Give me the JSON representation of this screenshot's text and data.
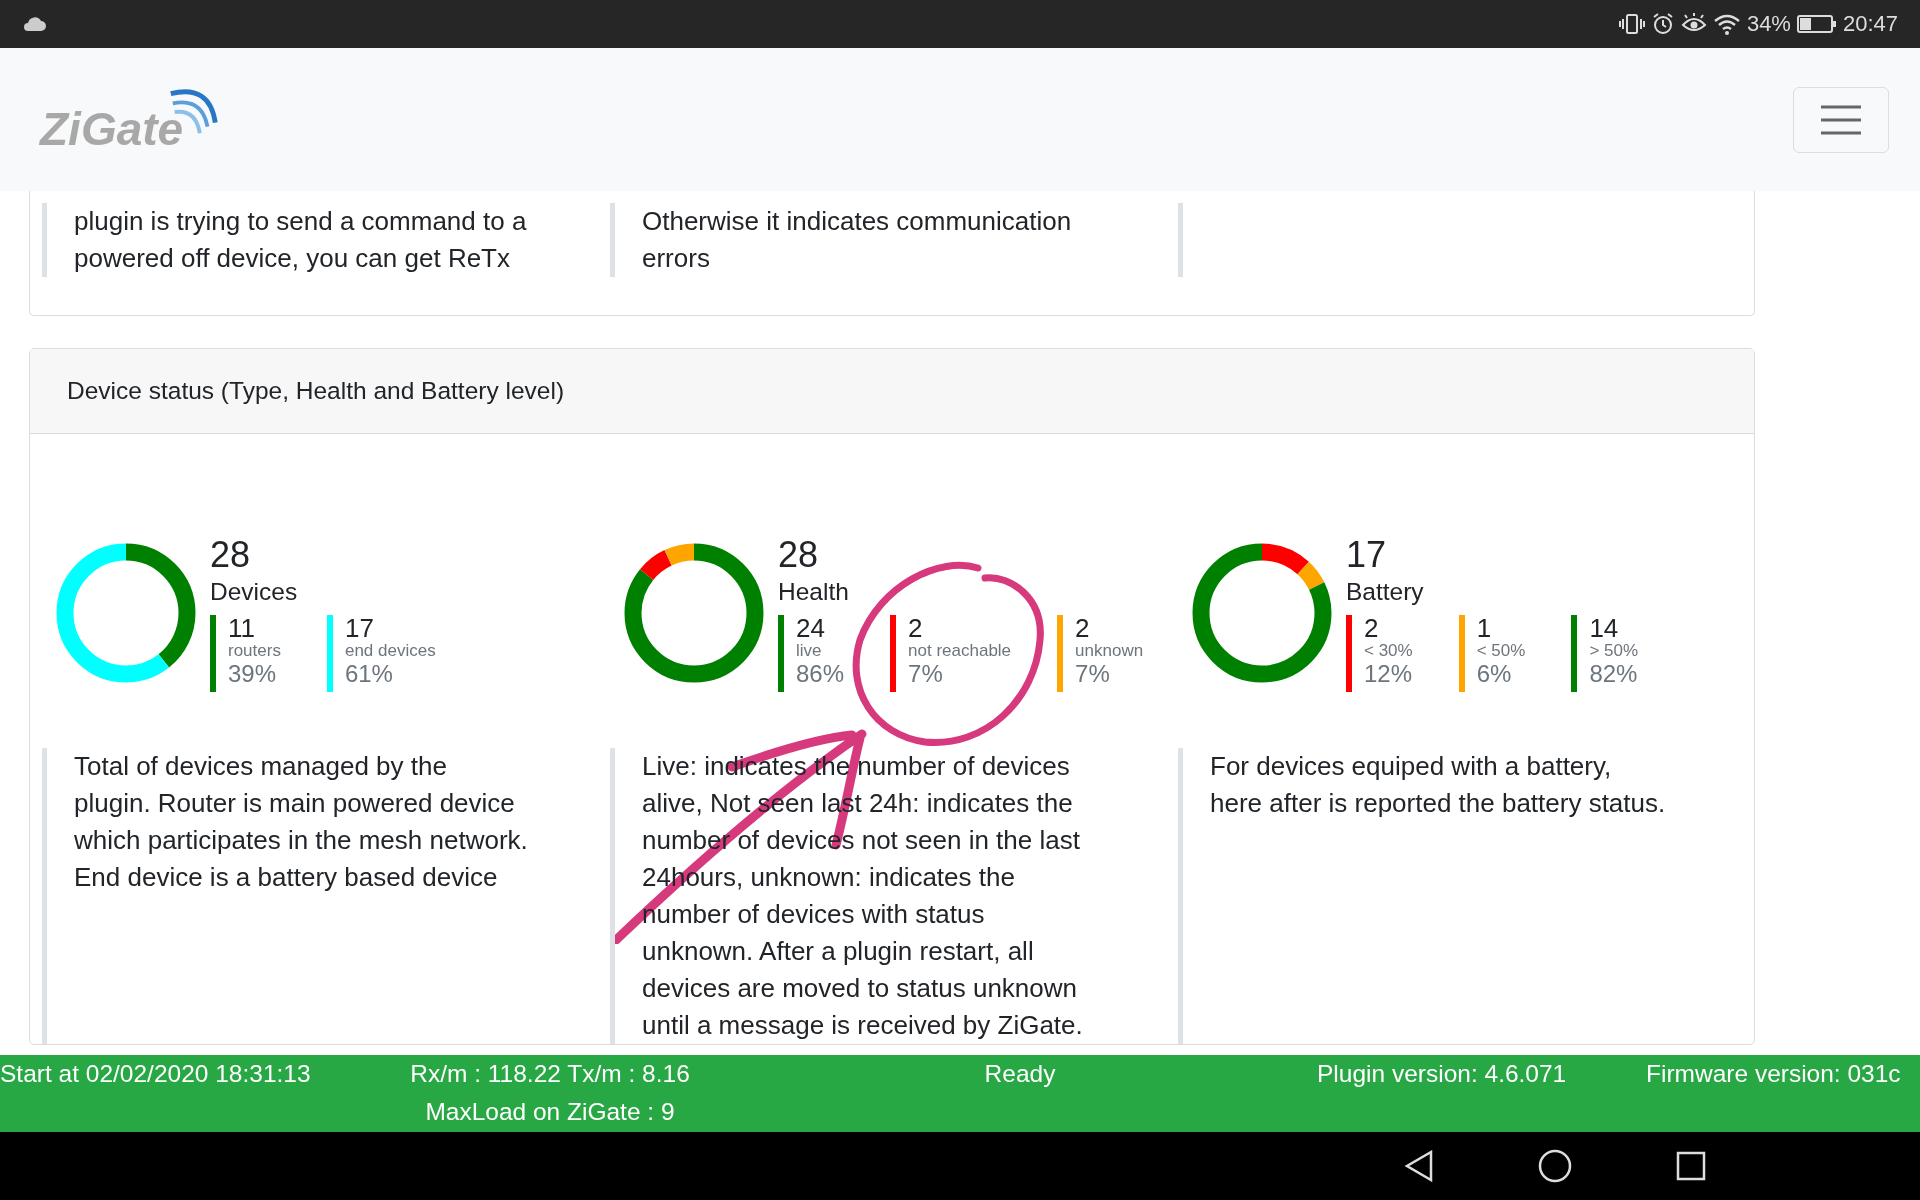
{
  "android_status_bar": {
    "battery": "34%",
    "time": "20:47"
  },
  "header": {
    "logo": "ZiGate"
  },
  "top_card": {
    "descriptions": [
      "plugin is trying to send a command to a powered off device, you can get ReTx",
      "Otherwise it indicates communication errors"
    ]
  },
  "device_status_card": {
    "title": "Device status (Type, Health and Battery level)",
    "stats": [
      {
        "total": "28",
        "label": "Devices",
        "items": [
          {
            "value": "11",
            "label": "routers",
            "percent": "39%",
            "color": "#008000"
          },
          {
            "value": "17",
            "label": "end devices",
            "percent": "61%",
            "color": "#00ffff"
          }
        ]
      },
      {
        "total": "28",
        "label": "Health",
        "items": [
          {
            "value": "24",
            "label": "live",
            "percent": "86%",
            "color": "#008000"
          },
          {
            "value": "2",
            "label": "not reachable",
            "percent": "7%",
            "color": "#ff0000"
          },
          {
            "value": "2",
            "label": "unknown",
            "percent": "7%",
            "color": "#ffa500"
          }
        ]
      },
      {
        "total": "17",
        "label": "Battery",
        "items": [
          {
            "value": "2",
            "label": "< 30%",
            "percent": "12%",
            "color": "#ff0000"
          },
          {
            "value": "1",
            "label": "< 50%",
            "percent": "6%",
            "color": "#ffa500"
          },
          {
            "value": "14",
            "label": "> 50%",
            "percent": "82%",
            "color": "#008000"
          }
        ]
      }
    ],
    "descriptions": [
      "Total of devices managed by the plugin. Router is main powered device which participates in the mesh network. End device is a battery based device",
      "Live: indicates the number of devices alive, Not seen last 24h: indicates the number of devices not seen in the last 24hours, unknown: indicates the number of devices with status unknown. After a plugin restart, all devices are moved to status unknown until a message is received by ZiGate.",
      "For devices equiped with a battery, here after is reported the battery status."
    ]
  },
  "footer": {
    "start": "Start at 02/02/2020 18:31:13",
    "rx": "Rx/m : 118.22",
    "tx": "Tx/m : 8.16",
    "maxload": "MaxLoad on ZiGate : 9",
    "status": "Ready",
    "plugin_version": "Plugin version: 4.6.071",
    "firmware_version": "Firmware version: 031c"
  }
}
